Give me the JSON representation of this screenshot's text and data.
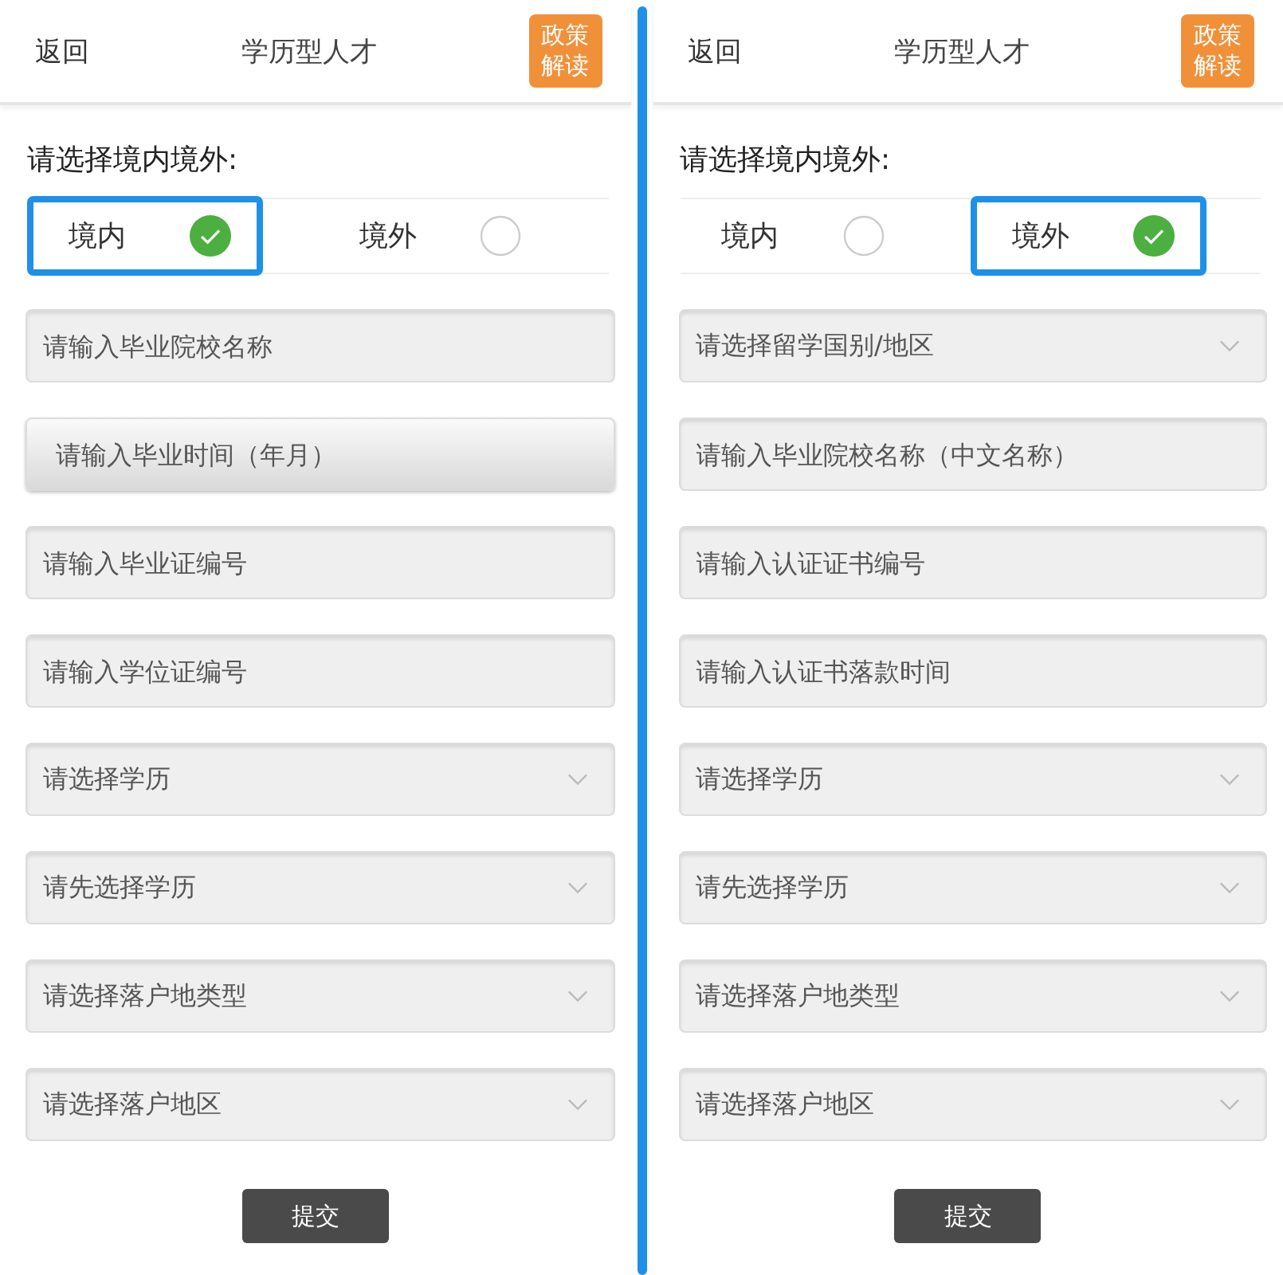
{
  "panels": [
    {
      "back": "返回",
      "title": "学历型人才",
      "policy_button": "政策解读",
      "region_label": "请选择境内境外:",
      "options": [
        {
          "label": "境内",
          "selected": true
        },
        {
          "label": "境外",
          "selected": false
        }
      ],
      "fields": [
        {
          "kind": "input",
          "placeholder": "请输入毕业院校名称",
          "pressed": false
        },
        {
          "kind": "input",
          "placeholder": "请输入毕业时间（年月）",
          "pressed": true
        },
        {
          "kind": "input",
          "placeholder": "请输入毕业证编号",
          "pressed": false
        },
        {
          "kind": "input",
          "placeholder": "请输入学位证编号",
          "pressed": false
        },
        {
          "kind": "select",
          "placeholder": "请选择学历",
          "pressed": false
        },
        {
          "kind": "select",
          "placeholder": "请先选择学历",
          "pressed": false
        },
        {
          "kind": "select",
          "placeholder": "请选择落户地类型",
          "pressed": false
        },
        {
          "kind": "select",
          "placeholder": "请选择落户地区",
          "pressed": false
        }
      ],
      "submit": "提交"
    },
    {
      "back": "返回",
      "title": "学历型人才",
      "policy_button": "政策解读",
      "region_label": "请选择境内境外:",
      "options": [
        {
          "label": "境内",
          "selected": false
        },
        {
          "label": "境外",
          "selected": true
        }
      ],
      "fields": [
        {
          "kind": "select",
          "placeholder": "请选择留学国别/地区",
          "pressed": false
        },
        {
          "kind": "input",
          "placeholder": "请输入毕业院校名称（中文名称）",
          "pressed": false
        },
        {
          "kind": "input",
          "placeholder": "请输入认证证书编号",
          "pressed": false
        },
        {
          "kind": "input",
          "placeholder": "请输入认证书落款时间",
          "pressed": false
        },
        {
          "kind": "select",
          "placeholder": "请选择学历",
          "pressed": false
        },
        {
          "kind": "select",
          "placeholder": "请先选择学历",
          "pressed": false
        },
        {
          "kind": "select",
          "placeholder": "请选择落户地类型",
          "pressed": false
        },
        {
          "kind": "select",
          "placeholder": "请选择落户地区",
          "pressed": false
        }
      ],
      "submit": "提交"
    }
  ]
}
